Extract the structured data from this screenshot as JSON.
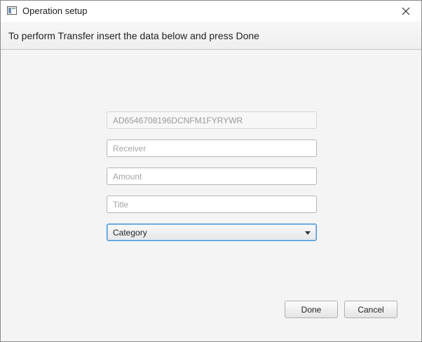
{
  "window": {
    "title": "Operation setup",
    "icon": "app-window-icon",
    "close_icon": "close-icon"
  },
  "header": {
    "instruction": "To perform Transfer insert the data below and press Done"
  },
  "form": {
    "account": {
      "value": "AD6546708196DCNFM1FYRYWR",
      "disabled": true
    },
    "receiver": {
      "placeholder": "Receiver",
      "value": ""
    },
    "amount": {
      "placeholder": "Amount",
      "value": ""
    },
    "title": {
      "placeholder": "Title",
      "value": ""
    },
    "category": {
      "selected": "Category"
    }
  },
  "buttons": {
    "done": "Done",
    "cancel": "Cancel"
  },
  "colors": {
    "focus_border": "#3a8fd6",
    "background": "#f4f4f4"
  }
}
